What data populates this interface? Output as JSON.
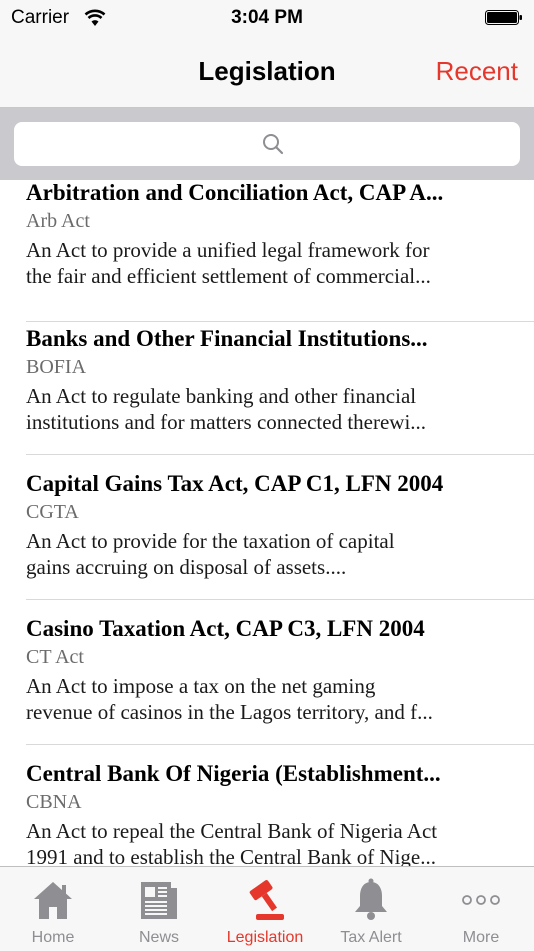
{
  "status": {
    "carrier": "Carrier",
    "time": "3:04 PM"
  },
  "nav": {
    "title": "Legislation",
    "right_button": "Recent"
  },
  "search": {
    "placeholder": ""
  },
  "items": [
    {
      "title": "Arbitration and Conciliation Act, CAP A...",
      "abbr": "Arb Act",
      "desc1": "An Act to provide a unified legal framework for",
      "desc2": "the fair and efficient settlement of commercial..."
    },
    {
      "title": "Banks and Other Financial Institutions...",
      "abbr": "BOFIA",
      "desc1": "An Act to regulate banking and other financial",
      "desc2": "institutions and for matters connected therewi..."
    },
    {
      "title": "Capital Gains Tax Act, CAP C1, LFN 2004",
      "abbr": "CGTA",
      "desc1": "An Act to provide for the taxation of capital",
      "desc2": "gains accruing on disposal of assets...."
    },
    {
      "title": "Casino Taxation Act, CAP C3, LFN 2004",
      "abbr": "CT Act",
      "desc1": "An Act to impose a tax on the net gaming",
      "desc2": "revenue of casinos in the Lagos territory, and f..."
    },
    {
      "title": "Central Bank Of Nigeria (Establishment...",
      "abbr": "CBNA",
      "desc1": "An Act to repeal the Central Bank of Nigeria Act",
      "desc2": "1991 and to establish the Central Bank of Nige..."
    }
  ],
  "tabs": [
    {
      "label": "Home",
      "icon": "home-icon"
    },
    {
      "label": "News",
      "icon": "newspaper-icon"
    },
    {
      "label": "Legislation",
      "icon": "gavel-icon",
      "active": true
    },
    {
      "label": "Tax Alert",
      "icon": "bell-icon"
    },
    {
      "label": "More",
      "icon": "more-icon"
    }
  ],
  "colors": {
    "accent": "#e5372b",
    "inactive": "#8e8e93"
  }
}
